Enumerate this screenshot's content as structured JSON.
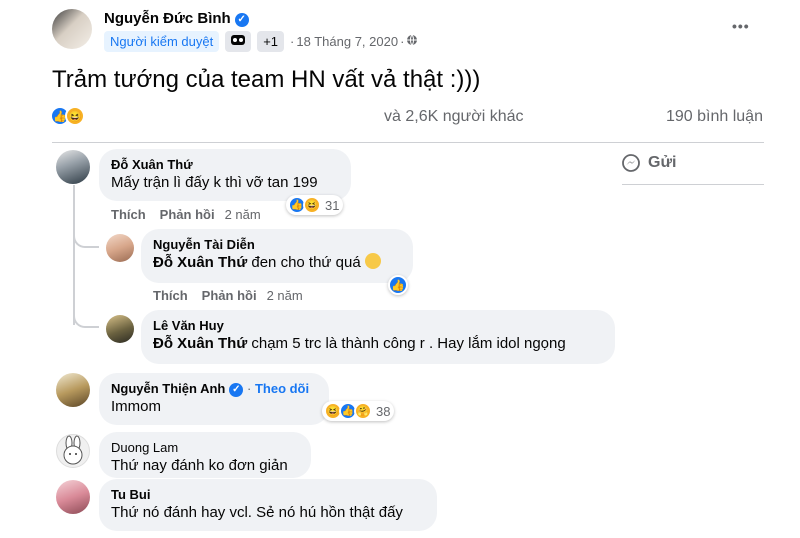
{
  "post": {
    "author": "Nguyễn Đức Bình",
    "role_badge": "Người kiểm duyệt",
    "plus_badge": "+1",
    "date": "18 Tháng 7, 2020",
    "text": "Trảm tướng của team HN vất vả thật :)))",
    "reactions_summary": "và 2,6K người khác",
    "comments_count": "190 bình luận",
    "menu_icon": "•••"
  },
  "side": {
    "send_label": "Gửi"
  },
  "comments": [
    {
      "name": "Đỗ Xuân Thứ",
      "text": "Mấy trận lì đấy k thì vỡ tan 199",
      "like_label": "Thích",
      "reply_label": "Phản hồi",
      "time": "2 năm",
      "reaction_count": "31"
    },
    {
      "name": "Nguyễn Tài Diễn",
      "mention": "Đỗ Xuân Thứ",
      "text": "đen cho thứ quá",
      "like_label": "Thích",
      "reply_label": "Phản hồi",
      "time": "2 năm"
    },
    {
      "name": "Lê Văn Huy",
      "mention": "Đỗ Xuân Thứ",
      "text": "chạm 5 trc là thành công r . Hay lắm idol ngọng"
    },
    {
      "name": "Nguyễn Thiện Anh",
      "follow_label": "Theo dõi",
      "text": "Immom",
      "reaction_count": "38"
    },
    {
      "name": "Duong Lam",
      "text": "Thứ nay đánh ko đơn giản"
    },
    {
      "name": "Tu Bui",
      "text": "Thứ nó đánh hay vcl. Sẻ nó hú hồn thật đấy"
    }
  ],
  "colors": {
    "accent": "#1877f2",
    "bubble": "#f0f2f5",
    "secondary_text": "#65676b"
  }
}
